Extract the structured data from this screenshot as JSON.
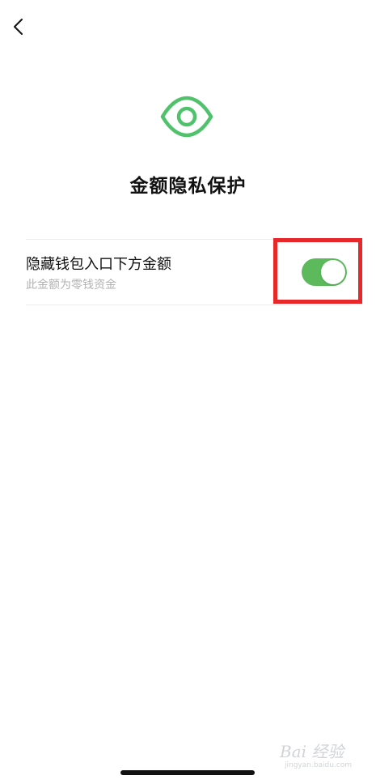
{
  "header": {
    "back_icon": "chevron-left-icon"
  },
  "hero": {
    "icon": "eye-icon",
    "title": "金额隐私保护"
  },
  "setting": {
    "title": "隐藏钱包入口下方金额",
    "subtitle": "此金额为零钱资金",
    "toggle_on": true
  },
  "watermark": {
    "main": "Bai 经验",
    "url": "jingyan.baidu.com"
  },
  "colors": {
    "accent": "#5cba5c",
    "eye": "#4fc26b",
    "highlight": "#e8272b",
    "subtitle": "#b2b2b2"
  }
}
